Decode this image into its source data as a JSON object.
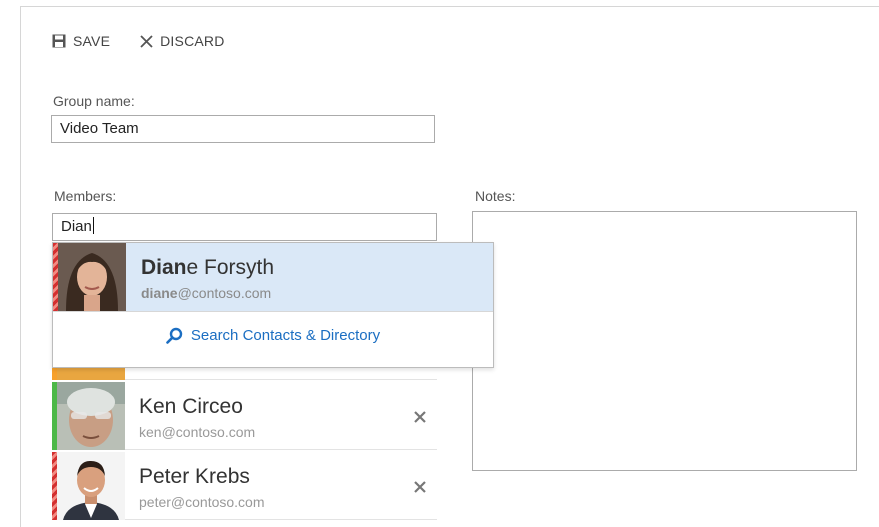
{
  "toolbar": {
    "save_label": "SAVE",
    "discard_label": "DISCARD"
  },
  "form": {
    "group_name_label": "Group name:",
    "group_name_value": "Video Team",
    "members_label": "Members:",
    "members_input_value": "Dian",
    "notes_label": "Notes:"
  },
  "suggestion": {
    "match": "Dian",
    "name_rest": "e Forsyth",
    "email_match": "diane",
    "email_rest": "@contoso.com",
    "presence_color": "#d32f2f",
    "search_link": "Search Contacts & Directory"
  },
  "members": [
    {
      "name": "Ken Circeo",
      "email": "ken@contoso.com",
      "presence": "available",
      "presence_color": "#4cb848"
    },
    {
      "name": "Peter Krebs",
      "email": "peter@contoso.com",
      "presence": "busy",
      "presence_color": "#d32f2f"
    }
  ],
  "colors": {
    "accent": "#1b6ec2",
    "selected_bg": "#dae8f7",
    "available": "#4cb848",
    "busy": "#d32f2f",
    "away": "#f7a12b"
  },
  "icons": {
    "save": "floppy-disk-icon",
    "discard": "close-icon",
    "remove": "close-icon",
    "search": "magnifier-icon"
  }
}
